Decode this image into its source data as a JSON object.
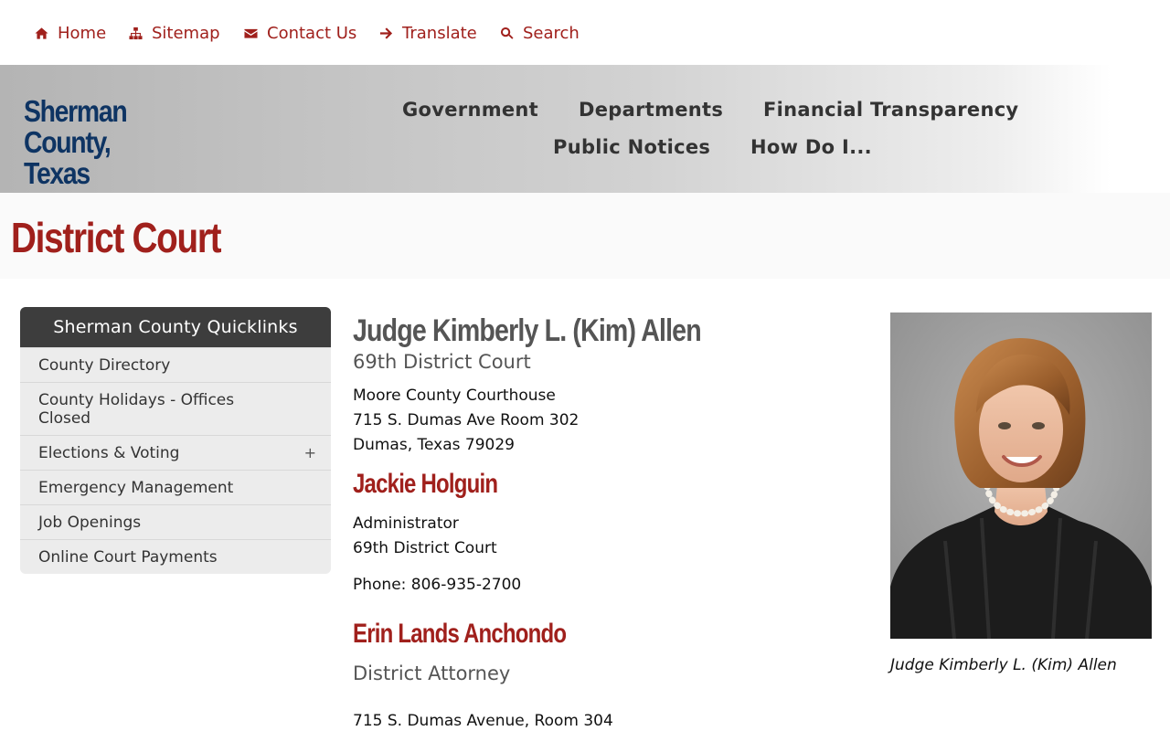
{
  "utility_nav": [
    {
      "label": "Home",
      "icon": "home-icon"
    },
    {
      "label": "Sitemap",
      "icon": "sitemap-icon"
    },
    {
      "label": "Contact Us",
      "icon": "envelope-icon"
    },
    {
      "label": "Translate",
      "icon": "arrow-right-icon"
    },
    {
      "label": "Search",
      "icon": "search-icon"
    }
  ],
  "brand": {
    "line1": "Sherman County,",
    "line2": "Texas"
  },
  "main_nav": [
    "Government",
    "Departments",
    "Financial Transparency",
    "Public Notices",
    "How Do I..."
  ],
  "page_title": "District Court",
  "sidebar": {
    "heading": "Sherman County Quicklinks",
    "items": [
      {
        "label": "County Directory"
      },
      {
        "label": "County Holidays - Offices Closed"
      },
      {
        "label": "Elections & Voting",
        "expander": "+"
      },
      {
        "label": "Emergency Management"
      },
      {
        "label": "Job Openings"
      },
      {
        "label": "Online Court Payments"
      }
    ]
  },
  "judge": {
    "name": "Judge Kimberly L. (Kim) Allen",
    "court": "69th District Court",
    "address": [
      "Moore County Courthouse",
      "715 S. Dumas Ave Room 302",
      "Dumas, Texas 79029"
    ]
  },
  "administrator": {
    "name": "Jackie Holguin",
    "title": "Administrator",
    "court": "69th District Court",
    "phone": "Phone: 806-935-2700"
  },
  "district_attorney": {
    "name": "Erin Lands Anchondo",
    "title": "District Attorney",
    "address_line": "715 S. Dumas Avenue, Room 304"
  },
  "photo": {
    "caption": "Judge Kimberly L. (Kim) Allen"
  },
  "colors": {
    "accent": "#a0201c",
    "brand": "#0e3463",
    "sidebar_header": "#3d3d3d",
    "sidebar_bg": "#ececec"
  }
}
